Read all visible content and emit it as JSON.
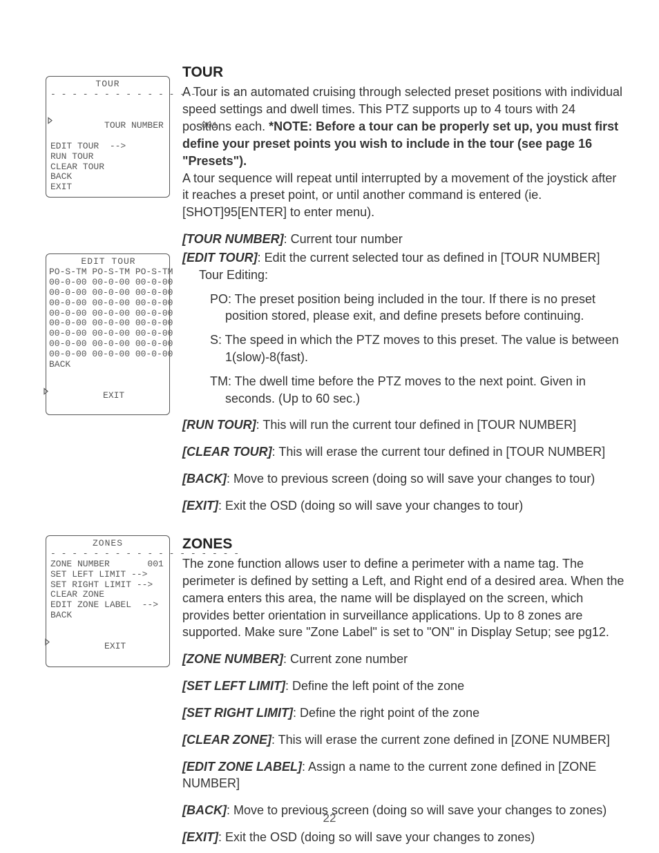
{
  "page_number": "22",
  "tour": {
    "heading": "TOUR",
    "intro_a": "A Tour is an automated cruising through selected preset positions with individual speed settings and dwell times. This PTZ supports up to 4 tours with 24 positions each. ",
    "intro_note": "*NOTE: Before a tour can be properly set up, you must first define your preset points you wish to include in the tour (see page 16 \"Presets\").",
    "intro_b": "A tour sequence will repeat until interrupted by a movement of the joystick after it reaches a preset point, or until another command is entered (ie. [SHOT]95[ENTER] to enter menu).",
    "defs": {
      "tour_number": {
        "label": "[TOUR NUMBER]",
        "text": ": Current tour number"
      },
      "edit_tour": {
        "label": "[EDIT TOUR]",
        "text": ": Edit the current selected tour as defined in [TOUR NUMBER]"
      },
      "edit_subhead": "Tour Editing:",
      "po": "PO: The preset position being included in the tour. If there is no preset position stored, please exit, and define presets before continuing.",
      "s": "S: The speed in which the PTZ moves to this preset. The value is between 1(slow)-8(fast).",
      "tm": "TM: The dwell time before the PTZ moves to the next point. Given in seconds. (Up to 60 sec.)",
      "run_tour": {
        "label": "[RUN TOUR]",
        "text": ": This will run the current tour defined in [TOUR NUMBER]"
      },
      "clear_tour": {
        "label": "[CLEAR TOUR]",
        "text": ": This will erase the current tour defined in [TOUR NUMBER]"
      },
      "back": {
        "label": "[BACK]",
        "text": ": Move to previous screen (doing so will save your changes to tour)"
      },
      "exit": {
        "label": "[EXIT]",
        "text": ": Exit the OSD (doing so will save your changes to tour)"
      }
    },
    "menu": {
      "title": "TOUR",
      "divider": "- - - - - - - - - - - - - - - - - -",
      "lines": [
        "TOUR NUMBER       001",
        "EDIT TOUR  -->",
        "RUN TOUR",
        "CLEAR TOUR",
        "BACK",
        "EXIT"
      ],
      "selected_index": 0
    },
    "edit_menu": {
      "title": "EDIT TOUR",
      "header": "PO-S-TM PO-S-TM PO-S-TM",
      "rows": [
        "00-0-00 00-0-00 00-0-00",
        "00-0-00 00-0-00 00-0-00",
        "00-0-00 00-0-00 00-0-00",
        "00-0-00 00-0-00 00-0-00",
        "00-0-00 00-0-00 00-0-00",
        "00-0-00 00-0-00 00-0-00",
        "00-0-00 00-0-00 00-0-00",
        "00-0-00 00-0-00 00-0-00"
      ],
      "back": "BACK",
      "exit": "EXIT",
      "selected_index": 9
    }
  },
  "zones": {
    "heading": "ZONES",
    "intro": "The zone function allows user to define a perimeter with a name tag. The perimeter is defined by setting a Left, and Right end of a desired area. When the camera enters this area, the name will be displayed on the screen, which provides better orientation in surveillance applications. Up to 8 zones are supported. Make sure \"Zone Label\" is set to \"ON\" in Display Setup; see pg12.",
    "defs": {
      "zone_number": {
        "label": "[ZONE NUMBER]",
        "text": ": Current zone number"
      },
      "set_left": {
        "label": "[SET LEFT LIMIT]",
        "text": ": Define the left point of the zone"
      },
      "set_right": {
        "label": "[SET RIGHT LIMIT]",
        "text": ": Define the right point of the zone"
      },
      "clear_zone": {
        "label": "[CLEAR ZONE]",
        "text": ": This will erase the current zone defined in [ZONE NUMBER]"
      },
      "edit_zone_label": {
        "label": "[EDIT ZONE LABEL]",
        "text": ": Assign a name to the current zone defined in [ZONE NUMBER]"
      },
      "back": {
        "label": "[BACK]",
        "text": ": Move to previous screen (doing so will save your changes to zones)"
      },
      "exit": {
        "label": "[EXIT]",
        "text": ": Exit the OSD (doing so will save your changes to zones)"
      }
    },
    "menu": {
      "title": "ZONES",
      "divider": "- - - - - - - - - - - - - - - - - -",
      "lines": [
        "ZONE NUMBER       001",
        "SET LEFT LIMIT -->",
        "SET RIGHT LIMIT -->",
        "CLEAR ZONE",
        "EDIT ZONE LABEL  -->",
        "BACK",
        "EXIT"
      ],
      "selected_index": 6
    }
  }
}
